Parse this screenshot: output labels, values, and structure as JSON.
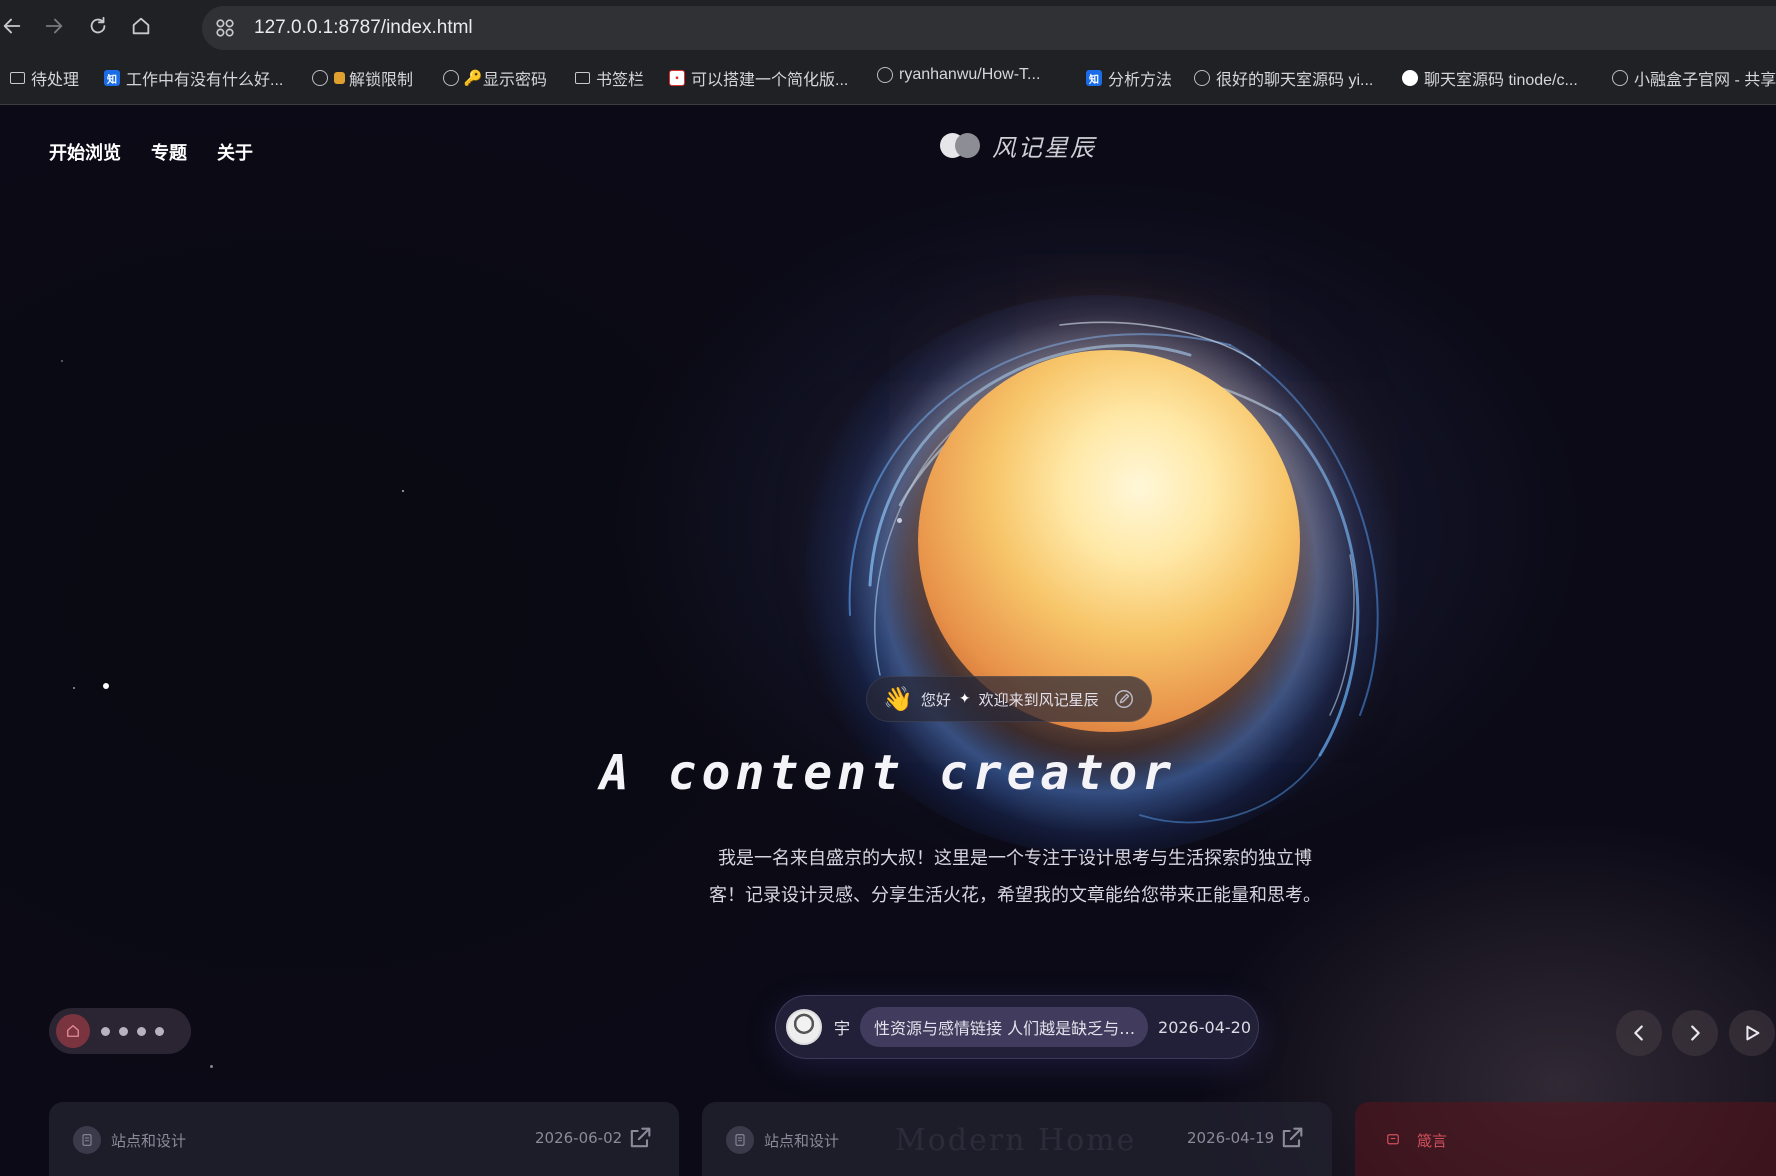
{
  "browser": {
    "url": "127.0.0.1:8787/index.html",
    "bookmarks": [
      {
        "label": "待处理",
        "icon": "folder-icon"
      },
      {
        "label": "工作中有没有什么好...",
        "icon": "zhihu-icon"
      },
      {
        "label": "解锁限制",
        "icon": "lock-icon"
      },
      {
        "label": "显示密码",
        "icon": "key-icon"
      },
      {
        "label": "书签栏",
        "icon": "folder-icon"
      },
      {
        "label": "可以搭建一个简化版...",
        "icon": "red-square-icon"
      },
      {
        "label": "ryanhanwu/How-T...",
        "icon": "globe-icon"
      },
      {
        "label": "分析方法",
        "icon": "zhihu-icon"
      },
      {
        "label": "很好的聊天室源码 yi...",
        "icon": "globe-icon"
      },
      {
        "label": "聊天室源码 tinode/c...",
        "icon": "github-icon"
      },
      {
        "label": "小融盒子官网 - 共享",
        "icon": "globe-icon"
      }
    ]
  },
  "nav": {
    "items": [
      "开始浏览",
      "专题",
      "关于"
    ]
  },
  "logo": {
    "text": "风记星辰"
  },
  "hero": {
    "greeting_prefix": "您好",
    "greeting_spark": "✦",
    "greeting_text": "欢迎来到风记星辰",
    "greeting_emoji": "👋",
    "headline": "A content creator",
    "intro_line1": "我是一名来自盛京的大叔！这里是一个专注于设计思考与生活探索的独立博",
    "intro_line2": "客！记录设计灵感、分享生活火花，希望我的文章能给您带来正能量和思考。"
  },
  "featured_post": {
    "author": "宇",
    "title": "性资源与感情链接 人们越是缺乏与…",
    "date": "2026-04-20"
  },
  "cards": [
    {
      "category": "站点和设计",
      "date": "2026-06-02",
      "watermark": ""
    },
    {
      "category": "站点和设计",
      "date": "2026-04-19",
      "watermark": "Modern Home"
    },
    {
      "category": "箴言",
      "date": ""
    }
  ],
  "colors": {
    "accent_red": "#d0505a",
    "background": "#0c0b17",
    "sun_core": "#ffe9a8",
    "halo_blue": "#5096ff"
  }
}
